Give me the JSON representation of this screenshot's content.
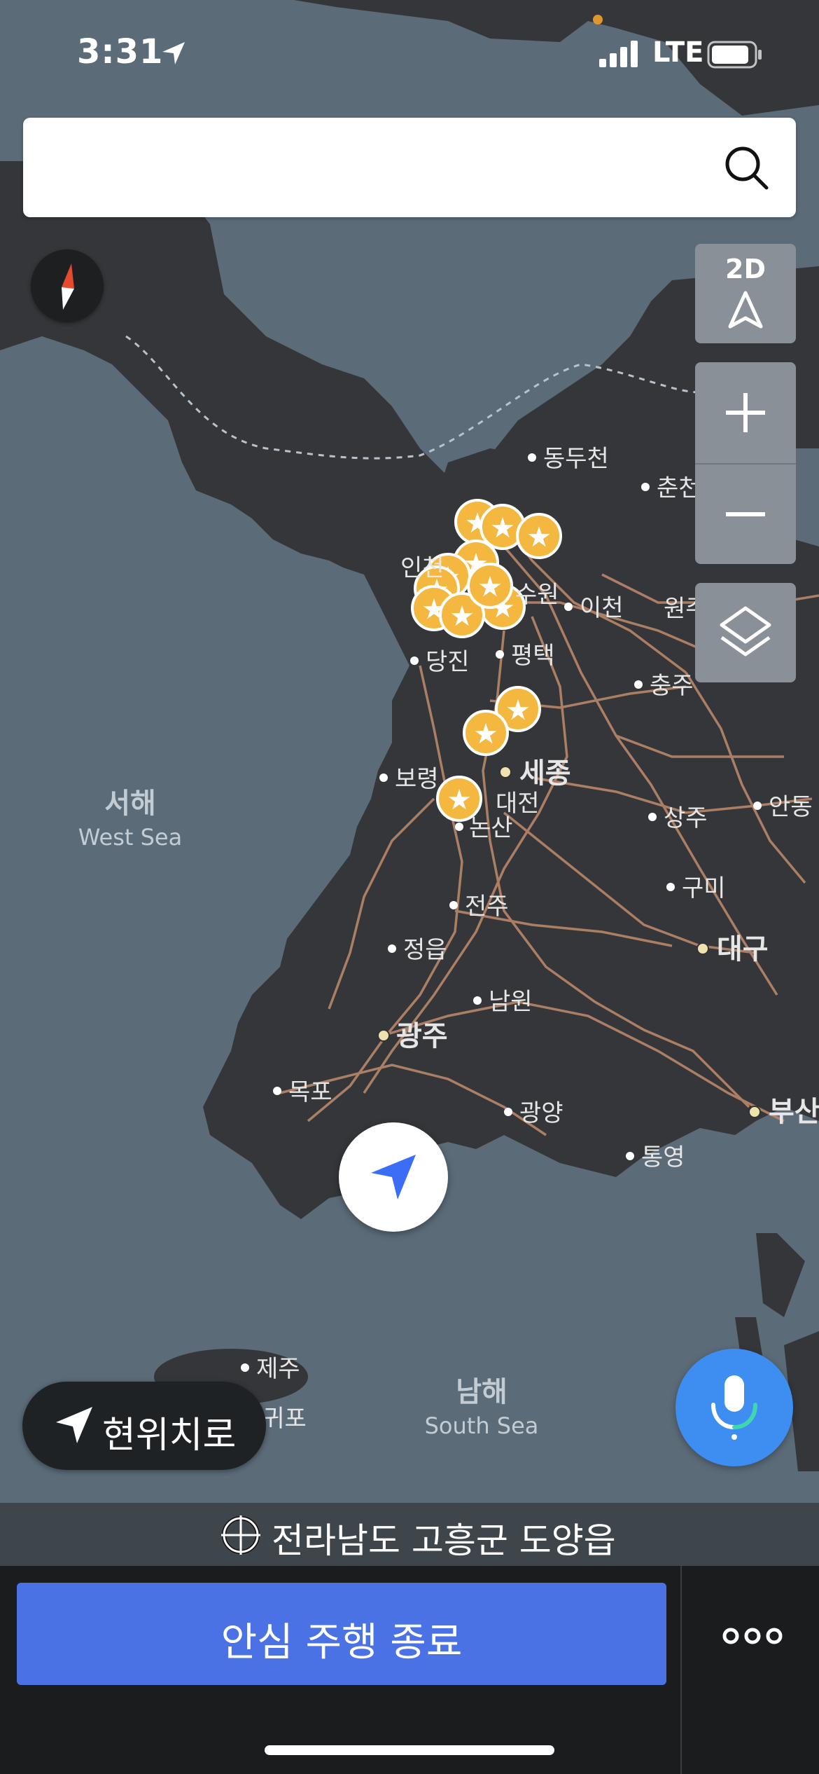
{
  "status_bar": {
    "time": "3:31",
    "network": "LTE"
  },
  "search": {
    "placeholder": ""
  },
  "controls": {
    "view_mode": "2D"
  },
  "map": {
    "sea_labels": [
      {
        "ko": "서해",
        "en": "West Sea"
      },
      {
        "ko": "남해",
        "en": "South Sea"
      }
    ],
    "cities": [
      "동두천",
      "춘천",
      "인천",
      "수원",
      "이천",
      "원주",
      "당진",
      "평택",
      "충주",
      "보령",
      "세종",
      "대전",
      "논산",
      "상주",
      "안동",
      "구미",
      "대구",
      "전주",
      "정읍",
      "남원",
      "광주",
      "목포",
      "광양",
      "부산",
      "통영",
      "제주",
      "서귀포"
    ]
  },
  "location_button": {
    "label": "현위치로"
  },
  "address_bar": {
    "text": "전라남도 고흥군 도양읍"
  },
  "bottom": {
    "end_label": "안심 주행 종료"
  },
  "icons": {
    "search": "search-icon",
    "compass": "compass-icon",
    "mic": "microphone-icon",
    "more": "more-icon"
  }
}
